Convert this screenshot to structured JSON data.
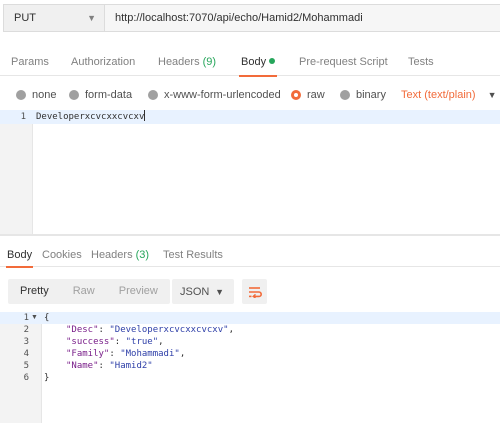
{
  "request": {
    "method": "PUT",
    "url": "http://localhost:7070/api/echo/Hamid2/Mohammadi"
  },
  "request_tabs": {
    "params": "Params",
    "authorization": "Authorization",
    "headers": "Headers",
    "headers_count": "(9)",
    "body": "Body",
    "pre_request": "Pre-request Script",
    "tests": "Tests"
  },
  "body_types": {
    "none": "none",
    "form_data": "form-data",
    "urlencoded": "x-www-form-urlencoded",
    "raw": "raw",
    "binary": "binary",
    "selected": "raw",
    "content_type": "Text (text/plain)"
  },
  "request_editor": {
    "line_number": "1",
    "text": "Developerxcvcxxcvcxv"
  },
  "response_tabs": {
    "body": "Body",
    "cookies": "Cookies",
    "headers": "Headers",
    "headers_count": "(3)",
    "test_results": "Test Results"
  },
  "response_toolbar": {
    "pretty": "Pretty",
    "raw": "Raw",
    "preview": "Preview",
    "format": "JSON"
  },
  "response_lines": {
    "l1": {
      "no": "1",
      "open": "{"
    },
    "l2": {
      "no": "2",
      "key": "\"Desc\"",
      "value": "\"Developerxcvcxxcvcxv\"",
      "sep": ": ",
      "end": ","
    },
    "l3": {
      "no": "3",
      "key": "\"success\"",
      "value": "\"true\"",
      "sep": ": ",
      "end": ","
    },
    "l4": {
      "no": "4",
      "key": "\"Family\"",
      "value": "\"Mohammadi\"",
      "sep": ": ",
      "end": ","
    },
    "l5": {
      "no": "5",
      "key": "\"Name\"",
      "value": "\"Hamid2\"",
      "sep": ": ",
      "end": ""
    },
    "l6": {
      "no": "6",
      "close": "}"
    }
  },
  "colors": {
    "accent": "#f26b3a",
    "count_green": "#26a65b",
    "json_key": "#7a1f8a",
    "json_string": "#2e3fa8"
  }
}
